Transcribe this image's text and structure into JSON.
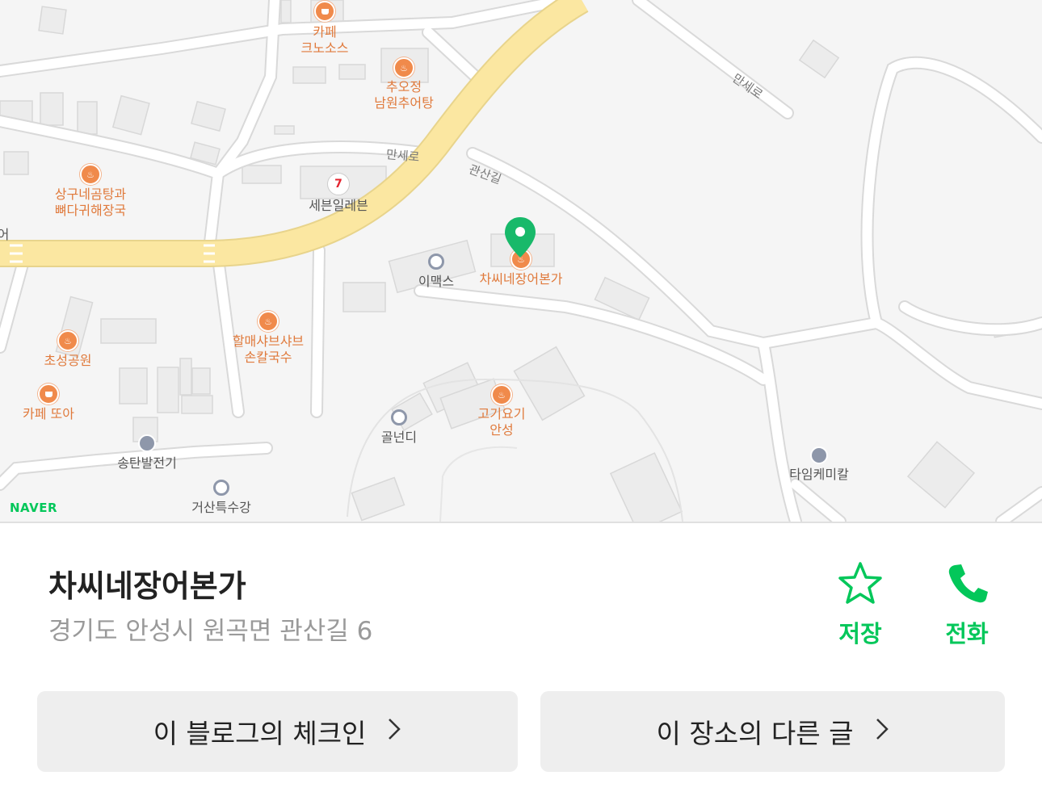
{
  "map": {
    "brand": "NAVER",
    "roads": [
      "만세로",
      "만세로",
      "관산길"
    ],
    "pois": [
      {
        "id": "cafe-cronos",
        "name": "카페\n크노소스",
        "kind": "cafe"
      },
      {
        "id": "chuojeong",
        "name": "추오정\n남원추어탕",
        "kind": "food"
      },
      {
        "id": "seven",
        "name": "세븐일레븐",
        "kind": "seven"
      },
      {
        "id": "sanggu",
        "name": "상구네곰탕과\n뼈다귀해장국",
        "kind": "food"
      },
      {
        "id": "imax",
        "name": "이맥스",
        "kind": "poi"
      },
      {
        "id": "target",
        "name": "차씨네장어본가",
        "kind": "food"
      },
      {
        "id": "halmae",
        "name": "할매샤브샤브\n손칼국수",
        "kind": "food"
      },
      {
        "id": "choseong",
        "name": "초성공원",
        "kind": "food"
      },
      {
        "id": "cafe-ttoa",
        "name": "카페 또아",
        "kind": "cafe"
      },
      {
        "id": "songtan",
        "name": "송탄발전기",
        "kind": "bld"
      },
      {
        "id": "golnundi",
        "name": "골넌디",
        "kind": "poi"
      },
      {
        "id": "gogiyogi",
        "name": "고기요기\n안성",
        "kind": "food"
      },
      {
        "id": "time-chem",
        "name": "타임케미칼",
        "kind": "bld"
      },
      {
        "id": "geosan",
        "name": "거산특수강",
        "kind": "poi"
      },
      {
        "id": "edge",
        "name": "어",
        "kind": "text"
      }
    ]
  },
  "place": {
    "name": "차씨네장어본가",
    "address": "경기도 안성시 원곡면 관산길 6"
  },
  "actions": {
    "save_label": "저장",
    "call_label": "전화",
    "color": "#03c75a"
  },
  "buttons": {
    "checkin_label": "이 블로그의 체크인",
    "other_posts_label": "이 장소의 다른 글"
  }
}
